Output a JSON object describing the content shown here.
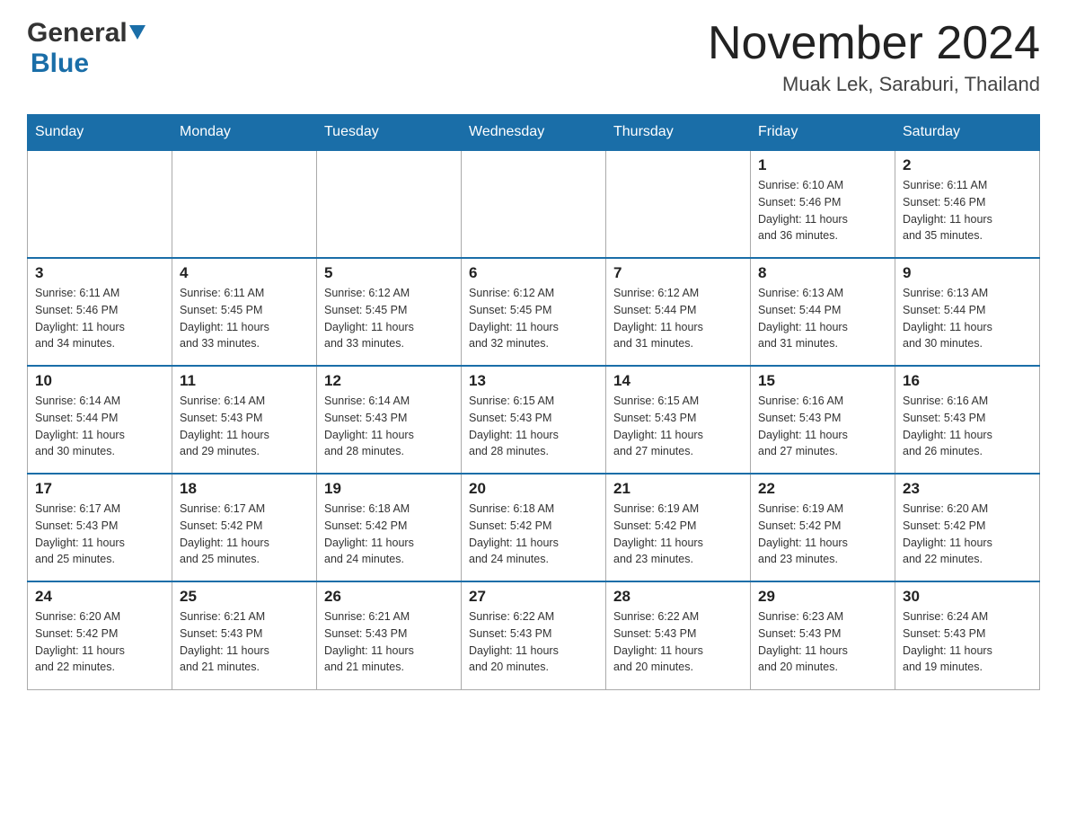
{
  "header": {
    "logo_general": "General",
    "logo_blue": "Blue",
    "title": "November 2024",
    "subtitle": "Muak Lek, Saraburi, Thailand"
  },
  "calendar": {
    "days_of_week": [
      "Sunday",
      "Monday",
      "Tuesday",
      "Wednesday",
      "Thursday",
      "Friday",
      "Saturday"
    ],
    "weeks": [
      {
        "days": [
          {
            "number": "",
            "info": ""
          },
          {
            "number": "",
            "info": ""
          },
          {
            "number": "",
            "info": ""
          },
          {
            "number": "",
            "info": ""
          },
          {
            "number": "",
            "info": ""
          },
          {
            "number": "1",
            "info": "Sunrise: 6:10 AM\nSunset: 5:46 PM\nDaylight: 11 hours\nand 36 minutes."
          },
          {
            "number": "2",
            "info": "Sunrise: 6:11 AM\nSunset: 5:46 PM\nDaylight: 11 hours\nand 35 minutes."
          }
        ]
      },
      {
        "days": [
          {
            "number": "3",
            "info": "Sunrise: 6:11 AM\nSunset: 5:46 PM\nDaylight: 11 hours\nand 34 minutes."
          },
          {
            "number": "4",
            "info": "Sunrise: 6:11 AM\nSunset: 5:45 PM\nDaylight: 11 hours\nand 33 minutes."
          },
          {
            "number": "5",
            "info": "Sunrise: 6:12 AM\nSunset: 5:45 PM\nDaylight: 11 hours\nand 33 minutes."
          },
          {
            "number": "6",
            "info": "Sunrise: 6:12 AM\nSunset: 5:45 PM\nDaylight: 11 hours\nand 32 minutes."
          },
          {
            "number": "7",
            "info": "Sunrise: 6:12 AM\nSunset: 5:44 PM\nDaylight: 11 hours\nand 31 minutes."
          },
          {
            "number": "8",
            "info": "Sunrise: 6:13 AM\nSunset: 5:44 PM\nDaylight: 11 hours\nand 31 minutes."
          },
          {
            "number": "9",
            "info": "Sunrise: 6:13 AM\nSunset: 5:44 PM\nDaylight: 11 hours\nand 30 minutes."
          }
        ]
      },
      {
        "days": [
          {
            "number": "10",
            "info": "Sunrise: 6:14 AM\nSunset: 5:44 PM\nDaylight: 11 hours\nand 30 minutes."
          },
          {
            "number": "11",
            "info": "Sunrise: 6:14 AM\nSunset: 5:43 PM\nDaylight: 11 hours\nand 29 minutes."
          },
          {
            "number": "12",
            "info": "Sunrise: 6:14 AM\nSunset: 5:43 PM\nDaylight: 11 hours\nand 28 minutes."
          },
          {
            "number": "13",
            "info": "Sunrise: 6:15 AM\nSunset: 5:43 PM\nDaylight: 11 hours\nand 28 minutes."
          },
          {
            "number": "14",
            "info": "Sunrise: 6:15 AM\nSunset: 5:43 PM\nDaylight: 11 hours\nand 27 minutes."
          },
          {
            "number": "15",
            "info": "Sunrise: 6:16 AM\nSunset: 5:43 PM\nDaylight: 11 hours\nand 27 minutes."
          },
          {
            "number": "16",
            "info": "Sunrise: 6:16 AM\nSunset: 5:43 PM\nDaylight: 11 hours\nand 26 minutes."
          }
        ]
      },
      {
        "days": [
          {
            "number": "17",
            "info": "Sunrise: 6:17 AM\nSunset: 5:43 PM\nDaylight: 11 hours\nand 25 minutes."
          },
          {
            "number": "18",
            "info": "Sunrise: 6:17 AM\nSunset: 5:42 PM\nDaylight: 11 hours\nand 25 minutes."
          },
          {
            "number": "19",
            "info": "Sunrise: 6:18 AM\nSunset: 5:42 PM\nDaylight: 11 hours\nand 24 minutes."
          },
          {
            "number": "20",
            "info": "Sunrise: 6:18 AM\nSunset: 5:42 PM\nDaylight: 11 hours\nand 24 minutes."
          },
          {
            "number": "21",
            "info": "Sunrise: 6:19 AM\nSunset: 5:42 PM\nDaylight: 11 hours\nand 23 minutes."
          },
          {
            "number": "22",
            "info": "Sunrise: 6:19 AM\nSunset: 5:42 PM\nDaylight: 11 hours\nand 23 minutes."
          },
          {
            "number": "23",
            "info": "Sunrise: 6:20 AM\nSunset: 5:42 PM\nDaylight: 11 hours\nand 22 minutes."
          }
        ]
      },
      {
        "days": [
          {
            "number": "24",
            "info": "Sunrise: 6:20 AM\nSunset: 5:42 PM\nDaylight: 11 hours\nand 22 minutes."
          },
          {
            "number": "25",
            "info": "Sunrise: 6:21 AM\nSunset: 5:43 PM\nDaylight: 11 hours\nand 21 minutes."
          },
          {
            "number": "26",
            "info": "Sunrise: 6:21 AM\nSunset: 5:43 PM\nDaylight: 11 hours\nand 21 minutes."
          },
          {
            "number": "27",
            "info": "Sunrise: 6:22 AM\nSunset: 5:43 PM\nDaylight: 11 hours\nand 20 minutes."
          },
          {
            "number": "28",
            "info": "Sunrise: 6:22 AM\nSunset: 5:43 PM\nDaylight: 11 hours\nand 20 minutes."
          },
          {
            "number": "29",
            "info": "Sunrise: 6:23 AM\nSunset: 5:43 PM\nDaylight: 11 hours\nand 20 minutes."
          },
          {
            "number": "30",
            "info": "Sunrise: 6:24 AM\nSunset: 5:43 PM\nDaylight: 11 hours\nand 19 minutes."
          }
        ]
      }
    ]
  }
}
